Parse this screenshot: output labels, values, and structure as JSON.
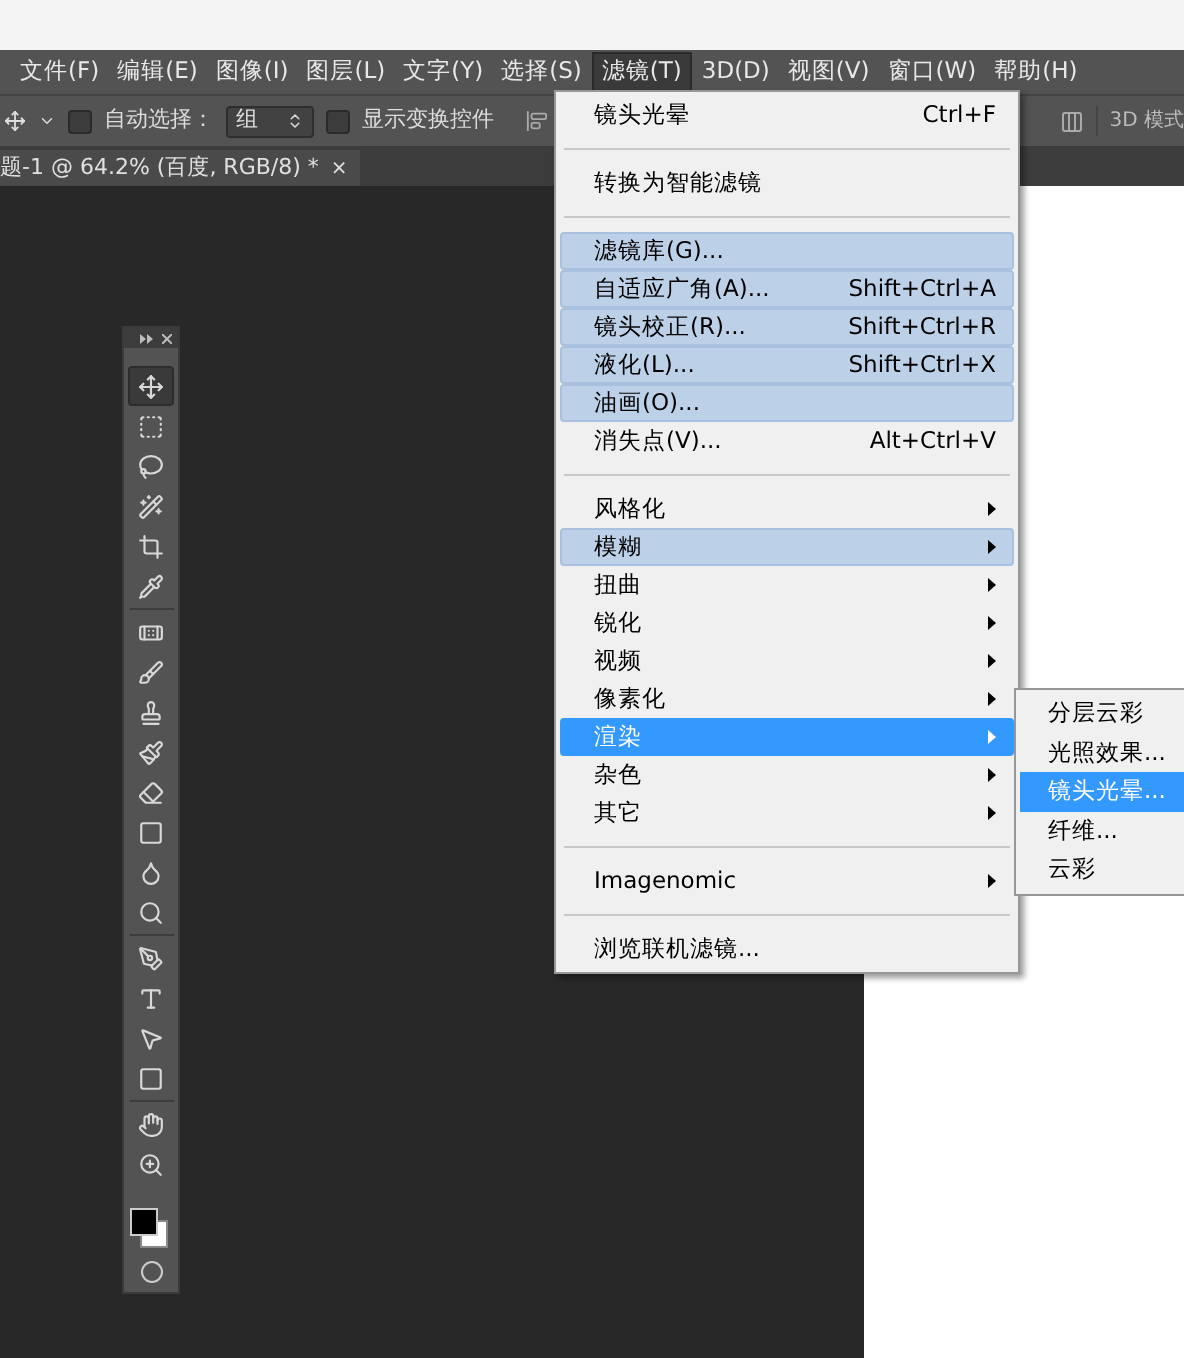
{
  "menubar": [
    {
      "label": "文件(F)",
      "selected": false
    },
    {
      "label": "编辑(E)",
      "selected": false
    },
    {
      "label": "图像(I)",
      "selected": false
    },
    {
      "label": "图层(L)",
      "selected": false
    },
    {
      "label": "文字(Y)",
      "selected": false
    },
    {
      "label": "选择(S)",
      "selected": false
    },
    {
      "label": "滤镜(T)",
      "selected": true
    },
    {
      "label": "3D(D)",
      "selected": false
    },
    {
      "label": "视图(V)",
      "selected": false
    },
    {
      "label": "窗口(W)",
      "selected": false
    },
    {
      "label": "帮助(H)",
      "selected": false
    }
  ],
  "options_bar": {
    "auto_select": {
      "label": "自动选择：",
      "checked": false
    },
    "group_select": {
      "value": "组"
    },
    "show_transform": {
      "label": "显示变换控件",
      "checked": false
    },
    "mode_3d": "3D 模式"
  },
  "document_tab": {
    "title": "题-1 @ 64.2% (百度, RGB/8) *",
    "close": "×"
  },
  "toolbox": {
    "tools": [
      {
        "selected": true
      },
      {
        "selected": false
      },
      {
        "selected": false
      },
      {
        "selected": false
      },
      {
        "selected": false
      },
      {
        "selected": false
      },
      {
        "selected": false
      },
      {
        "selected": false
      },
      {
        "selected": false
      },
      {
        "selected": false
      },
      {
        "selected": false
      },
      {
        "selected": false
      },
      {
        "selected": false
      },
      {
        "selected": false
      },
      {
        "selected": false
      },
      {
        "selected": false
      },
      {
        "selected": false
      },
      {
        "selected": false
      },
      {
        "selected": false
      },
      {
        "selected": false
      }
    ]
  },
  "filter_menu": [
    {
      "kind": "item",
      "label": "镜头光晕",
      "shortcut": "Ctrl+F",
      "highlighted": false,
      "selected": false,
      "submenu": false
    },
    {
      "kind": "separator"
    },
    {
      "kind": "item",
      "label": "转换为智能滤镜",
      "highlighted": false,
      "selected": false,
      "submenu": false
    },
    {
      "kind": "separator"
    },
    {
      "kind": "item",
      "label": "滤镜库(G)...",
      "highlighted": true,
      "selected": false,
      "submenu": false
    },
    {
      "kind": "item",
      "label": "自适应广角(A)...",
      "shortcut": "Shift+Ctrl+A",
      "highlighted": true,
      "selected": false,
      "submenu": false
    },
    {
      "kind": "item",
      "label": "镜头校正(R)...",
      "shortcut": "Shift+Ctrl+R",
      "highlighted": true,
      "selected": false,
      "submenu": false
    },
    {
      "kind": "item",
      "label": "液化(L)...",
      "shortcut": "Shift+Ctrl+X",
      "highlighted": true,
      "selected": false,
      "submenu": false
    },
    {
      "kind": "item",
      "label": "油画(O)...",
      "highlighted": true,
      "selected": false,
      "submenu": false
    },
    {
      "kind": "item",
      "label": "消失点(V)...",
      "shortcut": "Alt+Ctrl+V",
      "highlighted": false,
      "selected": false,
      "submenu": false
    },
    {
      "kind": "separator"
    },
    {
      "kind": "item",
      "label": "风格化",
      "highlighted": false,
      "selected": false,
      "submenu": true
    },
    {
      "kind": "item",
      "label": "模糊",
      "highlighted": true,
      "selected": false,
      "submenu": true
    },
    {
      "kind": "item",
      "label": "扭曲",
      "highlighted": false,
      "selected": false,
      "submenu": true
    },
    {
      "kind": "item",
      "label": "锐化",
      "highlighted": false,
      "selected": false,
      "submenu": true
    },
    {
      "kind": "item",
      "label": "视频",
      "highlighted": false,
      "selected": false,
      "submenu": true
    },
    {
      "kind": "item",
      "label": "像素化",
      "highlighted": false,
      "selected": false,
      "submenu": true
    },
    {
      "kind": "item",
      "label": "渲染",
      "highlighted": false,
      "selected": true,
      "submenu": true
    },
    {
      "kind": "item",
      "label": "杂色",
      "highlighted": false,
      "selected": false,
      "submenu": true
    },
    {
      "kind": "item",
      "label": "其它",
      "highlighted": false,
      "selected": false,
      "submenu": true
    },
    {
      "kind": "separator"
    },
    {
      "kind": "item",
      "label": "Imagenomic",
      "highlighted": false,
      "selected": false,
      "submenu": true
    },
    {
      "kind": "separator"
    },
    {
      "kind": "item",
      "label": "浏览联机滤镜...",
      "highlighted": false,
      "selected": false,
      "submenu": false
    }
  ],
  "render_submenu": [
    {
      "label": "分层云彩",
      "selected": false
    },
    {
      "label": "光照效果...",
      "selected": false
    },
    {
      "label": "镜头光晕...",
      "selected": true
    },
    {
      "label": "纤维...",
      "selected": false
    },
    {
      "label": "云彩",
      "selected": false
    }
  ]
}
